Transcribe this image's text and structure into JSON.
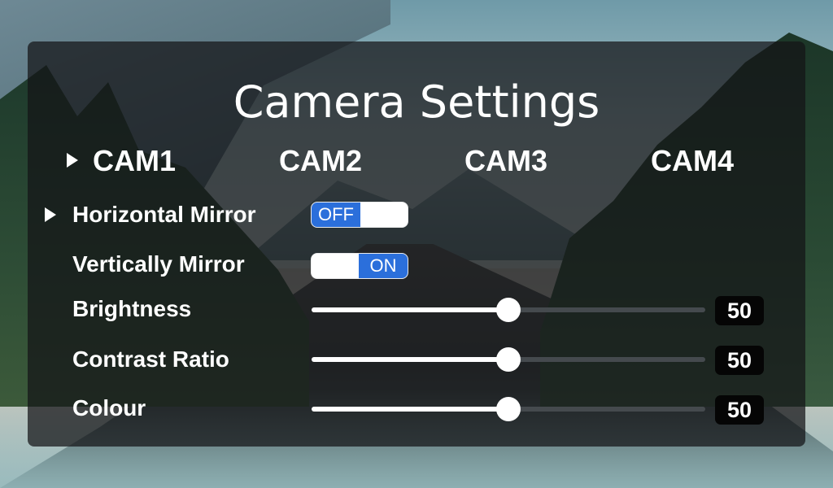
{
  "page": {
    "title": "Camera Settings"
  },
  "tabs": [
    {
      "label": "CAM1",
      "selected": true
    },
    {
      "label": "CAM2",
      "selected": false
    },
    {
      "label": "CAM3",
      "selected": false
    },
    {
      "label": "CAM4",
      "selected": false
    }
  ],
  "settings": {
    "horizontal_mirror": {
      "label": "Horizontal Mirror",
      "state": "OFF",
      "selected": true
    },
    "vertical_mirror": {
      "label": "Vertically Mirror",
      "state": "ON"
    },
    "brightness": {
      "label": "Brightness",
      "value": 50,
      "value_text": "50",
      "max": 100
    },
    "contrast": {
      "label": "Contrast Ratio",
      "value": 50,
      "value_text": "50",
      "max": 100
    },
    "colour": {
      "label": "Colour",
      "value": 50,
      "value_text": "50",
      "max": 100
    }
  },
  "icons": {
    "selection_marker": "triangle-right-icon"
  },
  "colors": {
    "accent": "#2b6fdb",
    "panel_bg": "#141416",
    "value_box": "#050505"
  }
}
